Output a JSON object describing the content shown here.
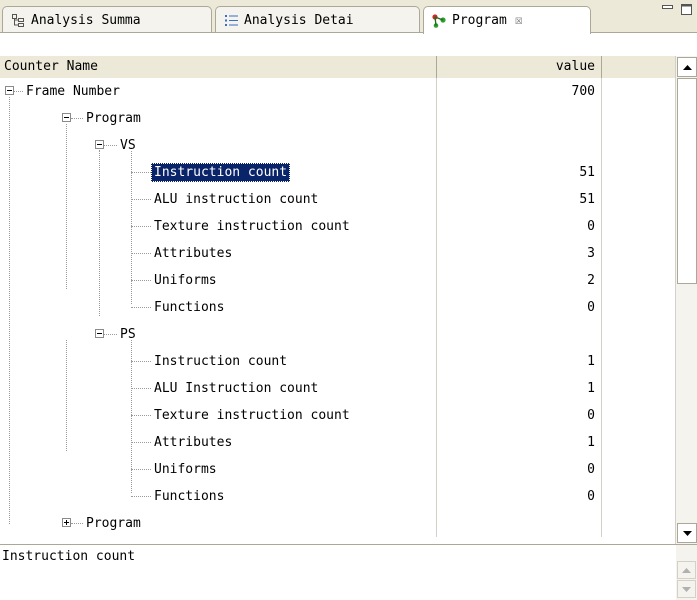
{
  "tabs": [
    {
      "label": "Analysis Summa",
      "icon": "tree-summary-icon"
    },
    {
      "label": "Analysis Detai",
      "icon": "list-detail-icon"
    },
    {
      "label": "Program",
      "icon": "program-graph-icon",
      "close": "☒"
    }
  ],
  "table": {
    "columns": [
      "Counter Name",
      "value"
    ],
    "rows": [
      {
        "label": "Frame Number",
        "value": "700"
      },
      {
        "label": "Program",
        "value": ""
      },
      {
        "label": "VS",
        "value": ""
      },
      {
        "label": "Instruction count",
        "value": "51"
      },
      {
        "label": "ALU instruction count",
        "value": "51"
      },
      {
        "label": "Texture instruction count",
        "value": "0"
      },
      {
        "label": "Attributes",
        "value": "3"
      },
      {
        "label": "Uniforms",
        "value": "2"
      },
      {
        "label": "Functions",
        "value": "0"
      },
      {
        "label": "PS",
        "value": ""
      },
      {
        "label": "Instruction count",
        "value": "1"
      },
      {
        "label": "ALU Instruction count",
        "value": "1"
      },
      {
        "label": "Texture instruction count",
        "value": "0"
      },
      {
        "label": "Attributes",
        "value": "1"
      },
      {
        "label": "Uniforms",
        "value": "0"
      },
      {
        "label": "Functions",
        "value": "0"
      },
      {
        "label": "Program",
        "value": ""
      }
    ]
  },
  "detail": {
    "text": "Instruction count"
  },
  "colors": {
    "selection": "#0a246a",
    "program_icon_green": "#2e9e2e",
    "program_icon_red": "#d02828"
  }
}
